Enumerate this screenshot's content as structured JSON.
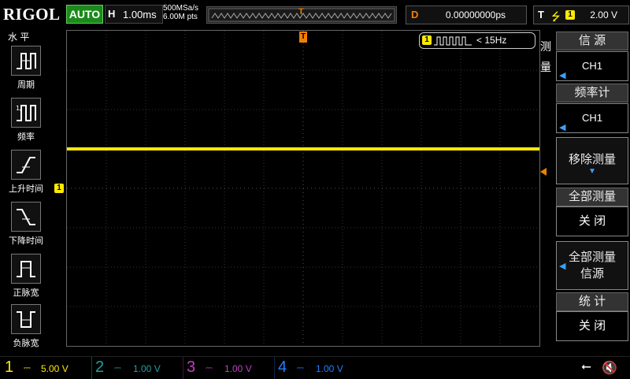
{
  "header": {
    "brand": "RIGOL",
    "auto_label": "AUTO",
    "timebase_key": "H",
    "timebase_value": "1.00ms",
    "sample_rate": "500MSa/s",
    "memory_depth": "6.00M pts",
    "trigger_marker": "T",
    "delay_key": "D",
    "delay_value": "0.00000000ps",
    "trigger_key": "T",
    "trigger_source": "1",
    "trigger_level": "2.00 V"
  },
  "left_panel": {
    "title": "水 平",
    "items": [
      {
        "label": "周期",
        "icon": "period-icon"
      },
      {
        "label": "频率",
        "icon": "frequency-icon"
      },
      {
        "label": "上升时间",
        "icon": "rise-time-icon"
      },
      {
        "label": "下降时间",
        "icon": "fall-time-icon"
      },
      {
        "label": "正脉宽",
        "icon": "positive-width-icon"
      },
      {
        "label": "负脉宽",
        "icon": "negative-width-icon"
      }
    ]
  },
  "screen": {
    "channel_marker": "1",
    "trigger_top_marker": "T",
    "measurement": {
      "channel": "1",
      "text": "< 15Hz"
    },
    "trace_color": "#ffea00"
  },
  "right_panel": {
    "menu_title_chars": [
      "测",
      "量"
    ],
    "source_title": "信 源",
    "source_value": "CH1",
    "freq_title": "频率计",
    "freq_value": "CH1",
    "remove_label": "移除测量",
    "all_measure_title": "全部测量",
    "all_measure_value": "关 闭",
    "all_source_label1": "全部测量",
    "all_source_label2": "信源",
    "stats_title": "统 计",
    "stats_value": "关 闭"
  },
  "footer": {
    "channels": [
      {
        "num": "1",
        "value": "5.00 V",
        "color": "#ffea00"
      },
      {
        "num": "2",
        "value": "1.00 V",
        "color": "#1fa0a0"
      },
      {
        "num": "3",
        "value": "1.00 V",
        "color": "#c040c0"
      },
      {
        "num": "4",
        "value": "1.00 V",
        "color": "#2080ff"
      }
    ]
  },
  "colors": {
    "ch1": "#ffea00",
    "accent": "#f08000",
    "auto": "#1a8a1a"
  }
}
